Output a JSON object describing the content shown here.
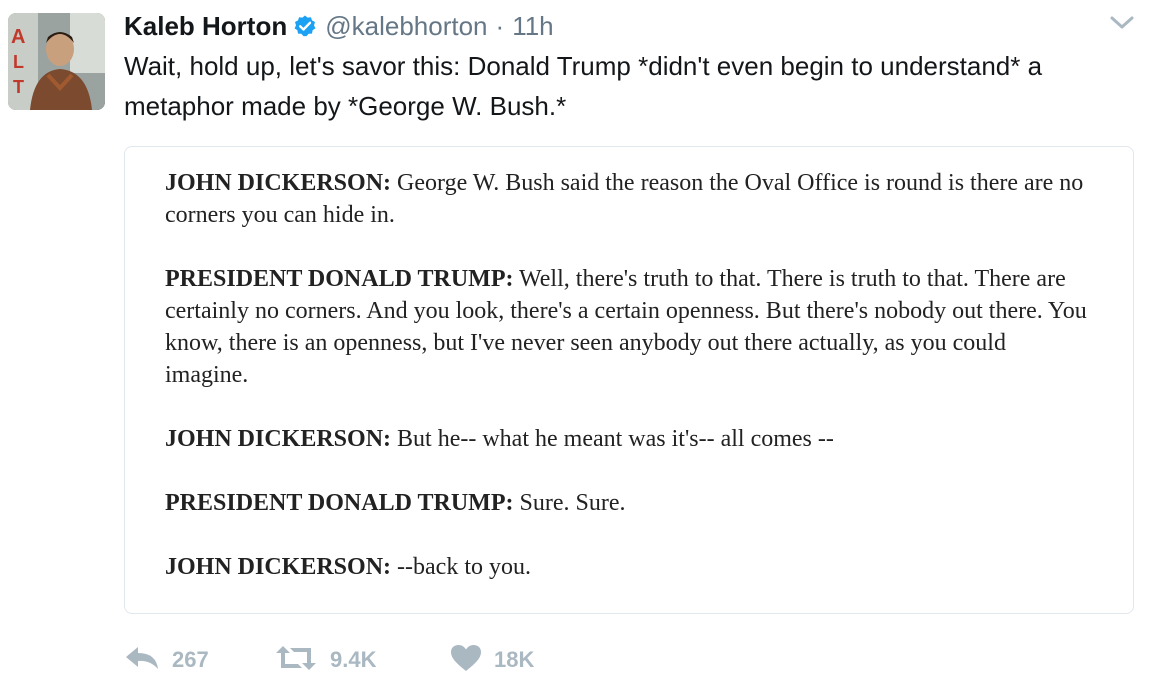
{
  "tweet": {
    "author_name": "Kaleb Horton",
    "handle": "@kalebhorton",
    "separator": "·",
    "time": "11h",
    "text": "Wait, hold up, let's savor this: Donald Trump *didn't even begin to understand* a\nmetaphor made by *George W. Bush.*",
    "verified": true,
    "accent_color": "#1da1f2"
  },
  "quote": {
    "paragraphs": [
      {
        "speaker": "JOHN DICKERSON:",
        "text": " George W. Bush said the reason the Oval Office is round is there are no corners you can hide in."
      },
      {
        "speaker": "PRESIDENT DONALD TRUMP:",
        "text": " Well, there's truth to that. There is truth to that. There are certainly no corners. And you look, there's a certain openness. But there's nobody out there. You know, there is an openness, but I've never seen anybody out there actually, as you could imagine."
      },
      {
        "speaker": "JOHN DICKERSON:",
        "text": " But he-- what he meant was it's-- all comes --"
      },
      {
        "speaker": "PRESIDENT DONALD TRUMP:",
        "text": " Sure. Sure."
      },
      {
        "speaker": "JOHN DICKERSON:",
        "text": " --back to you."
      }
    ]
  },
  "actions": {
    "reply_count": "267",
    "retweet_count": "9.4K",
    "like_count": "18K",
    "icon_color": "#aab8c2",
    "icons": [
      "reply-icon",
      "retweet-icon",
      "heart-icon"
    ]
  }
}
